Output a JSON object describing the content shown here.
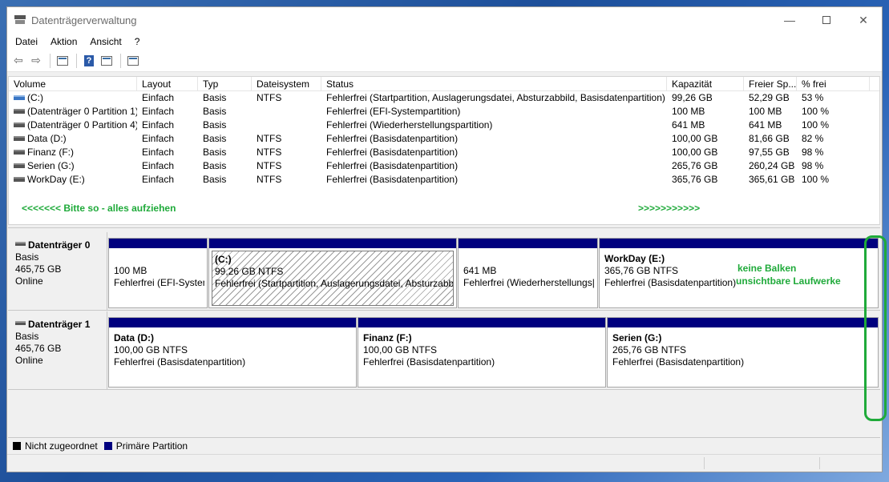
{
  "window": {
    "title": "Datenträgerverwaltung"
  },
  "menu": [
    "Datei",
    "Aktion",
    "Ansicht",
    "?"
  ],
  "toolbar": {
    "icons": [
      "back-arrow-icon",
      "forward-arrow-icon",
      "properties-icon",
      "help-icon",
      "disk-view-icon",
      "settings-list-icon"
    ]
  },
  "volume_list": {
    "headers": [
      "Volume",
      "Layout",
      "Typ",
      "Dateisystem",
      "Status",
      "Kapazität",
      "Freier Sp...",
      "% frei"
    ],
    "rows": [
      [
        "(C:)",
        "Einfach",
        "Basis",
        "NTFS",
        "Fehlerfrei (Startpartition, Auslagerungsdatei, Absturzabbild, Basisdatenpartition)",
        "99,26 GB",
        "52,29 GB",
        "53 %"
      ],
      [
        "(Datenträger 0 Partition 1)",
        "Einfach",
        "Basis",
        "",
        "Fehlerfrei (EFI-Systempartition)",
        "100 MB",
        "100 MB",
        "100 %"
      ],
      [
        "(Datenträger 0 Partition 4)",
        "Einfach",
        "Basis",
        "",
        "Fehlerfrei (Wiederherstellungspartition)",
        "641 MB",
        "641 MB",
        "100 %"
      ],
      [
        "Data (D:)",
        "Einfach",
        "Basis",
        "NTFS",
        "Fehlerfrei (Basisdatenpartition)",
        "100,00 GB",
        "81,66 GB",
        "82 %"
      ],
      [
        "Finanz (F:)",
        "Einfach",
        "Basis",
        "NTFS",
        "Fehlerfrei (Basisdatenpartition)",
        "100,00 GB",
        "97,55 GB",
        "98 %"
      ],
      [
        "Serien (G:)",
        "Einfach",
        "Basis",
        "NTFS",
        "Fehlerfrei (Basisdatenpartition)",
        "265,76 GB",
        "260,24 GB",
        "98 %"
      ],
      [
        "WorkDay (E:)",
        "Einfach",
        "Basis",
        "NTFS",
        "Fehlerfrei (Basisdatenpartition)",
        "365,76 GB",
        "365,61 GB",
        "100 %"
      ]
    ],
    "annotation_left": "<<<<<<<  Bitte so - alles aufziehen",
    "annotation_right": ">>>>>>>>>>>"
  },
  "disks": [
    {
      "name": "Datenträger 0",
      "type": "Basis",
      "size": "465,75 GB",
      "state": "Online",
      "partitions": [
        {
          "name": "",
          "size": "100 MB",
          "status": "Fehlerfrei (EFI-Systen"
        },
        {
          "name": "(C:)",
          "size": "99,26 GB NTFS",
          "status": "Fehlerfrei (Startpartition, Auslagerungsdatei, Absturzabb"
        },
        {
          "name": "",
          "size": "641 MB",
          "status": "Fehlerfrei (Wiederherstellungs|"
        },
        {
          "name": "WorkDay  (E:)",
          "size": "365,76 GB NTFS",
          "status": "Fehlerfrei (Basisdatenpartition)"
        }
      ]
    },
    {
      "name": "Datenträger 1",
      "type": "Basis",
      "size": "465,76 GB",
      "state": "Online",
      "partitions": [
        {
          "name": "Data  (D:)",
          "size": "100,00 GB NTFS",
          "status": "Fehlerfrei (Basisdatenpartition)"
        },
        {
          "name": "Finanz  (F:)",
          "size": "100,00 GB NTFS",
          "status": "Fehlerfrei (Basisdatenpartition)"
        },
        {
          "name": "Serien  (G:)",
          "size": "265,76 GB NTFS",
          "status": "Fehlerfrei (Basisdatenpartition)"
        }
      ]
    }
  ],
  "graph_annotation": {
    "line1": "keine Balken",
    "line2": "unsichtbare Laufwerke"
  },
  "legend": [
    {
      "label": "Nicht zugeordnet",
      "color": "#000000"
    },
    {
      "label": "Primäre Partition",
      "color": "#00007f"
    }
  ],
  "colors": {
    "partition_bar": "#00007f",
    "annotation": "#1faa3a"
  }
}
